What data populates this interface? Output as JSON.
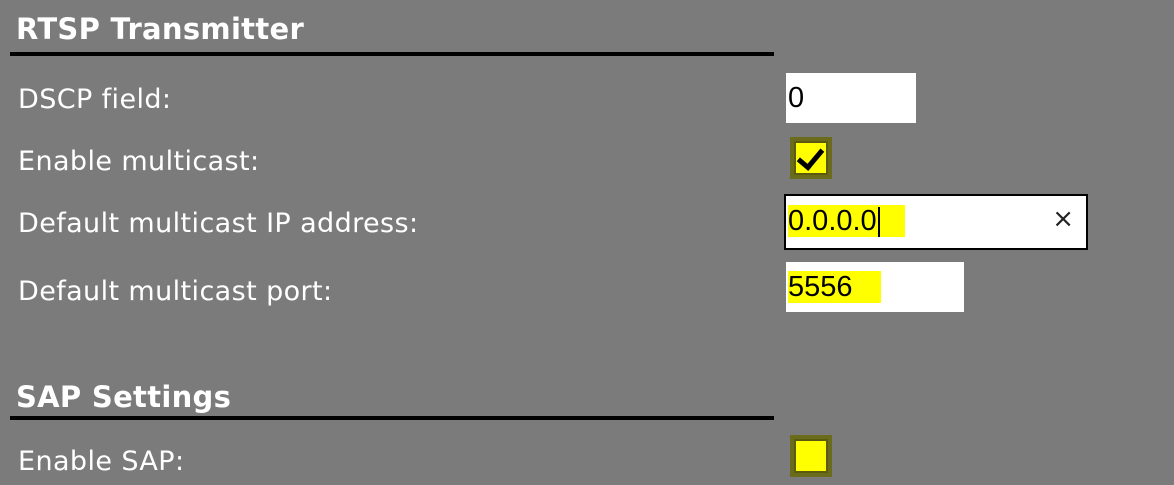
{
  "rtsp": {
    "title": "RTSP Transmitter",
    "dscp_label": "DSCP field:",
    "dscp_value": "0",
    "multicast_label": "Enable multicast:",
    "multicast_checked": true,
    "ip_label": "Default multicast IP address:",
    "ip_value": "0.0.0.0",
    "clear_icon": "×",
    "port_label": "Default multicast port:",
    "port_value": "5556"
  },
  "sap": {
    "title": "SAP Settings",
    "enable_label": "Enable SAP:",
    "enable_checked": false
  },
  "colors": {
    "background": "#7b7b7b",
    "highlight": "#ffff00"
  }
}
